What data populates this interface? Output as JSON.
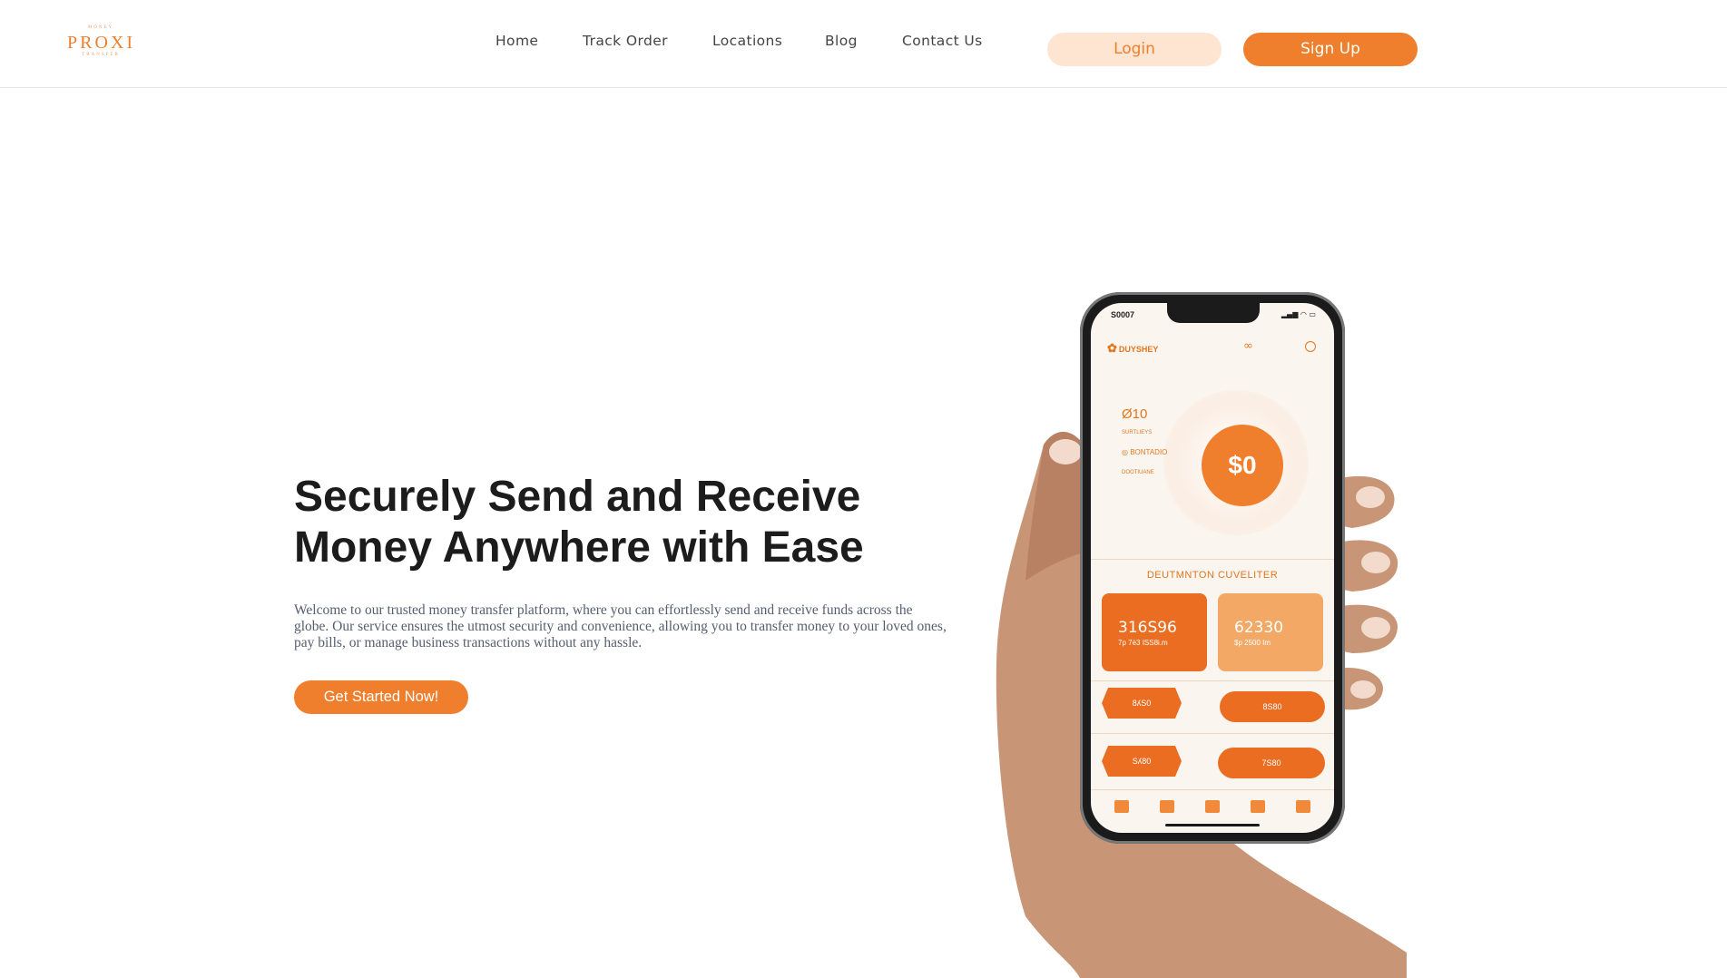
{
  "header": {
    "logo": {
      "top_text": "MONEY",
      "word": "PROXI",
      "bottom_text": "TRANSFER"
    },
    "nav": [
      {
        "label": "Home"
      },
      {
        "label": "Track Order"
      },
      {
        "label": "Locations"
      },
      {
        "label": "Blog"
      },
      {
        "label": "Contact Us"
      }
    ],
    "login_label": "Login",
    "signup_label": "Sign Up"
  },
  "hero": {
    "title_line1": "Securely Send and Receive",
    "title_line2": "Money Anywhere with Ease",
    "text": "Welcome to our trusted money transfer platform, where you can effortlessly send and receive funds across the globe. Our service ensures the utmost security and convenience, allowing you to transfer money to your loved ones, pay bills, or manage business transactions without any hassle.",
    "cta_label": "Get Started Now!"
  },
  "phone": {
    "time": "S0007",
    "signal": "▂▄▆ ◠ ▭",
    "brand": "DUYSHEY",
    "balance": "$0",
    "stat_value": "Ø10",
    "stat_label1": "SURTLIEYS",
    "stat_item": "BONTADIO",
    "stat_label2": "DOOTIUANE",
    "section_label": "DEUTMNTON CUVELITER",
    "card1": {
      "value": "316S96",
      "sub": "7p 7è3 ISS8i.m"
    },
    "card2": {
      "value": "62330",
      "sub": "$p 2500 Im"
    },
    "pills": [
      "8ʎS0",
      "8S80",
      "Sʎ80",
      "7S80"
    ]
  },
  "colors": {
    "accent": "#ef7f2d",
    "accent_light": "#fde5d1",
    "text_dark": "#1c1c1c",
    "text_muted": "#555e6d"
  }
}
